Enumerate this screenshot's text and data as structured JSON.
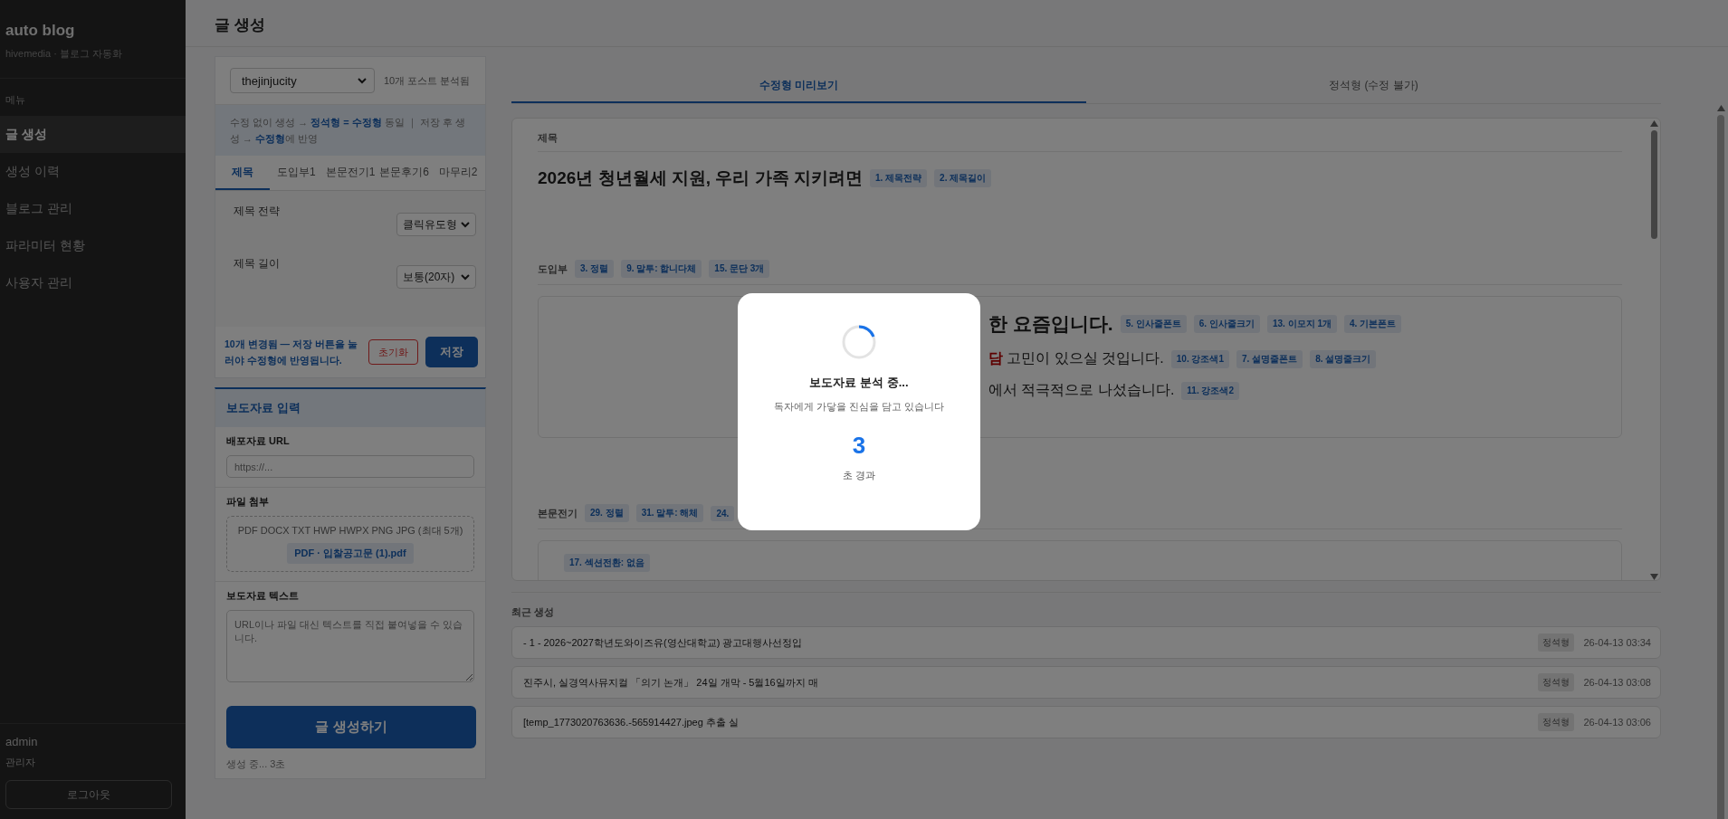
{
  "sidebar": {
    "brand": "auto blog",
    "subtitle": "hivemedia · 블로그 자동화",
    "section_label": "메뉴",
    "items": [
      {
        "label": "글 생성",
        "selected": true
      },
      {
        "label": "생성 이력",
        "selected": false
      },
      {
        "label": "블로그 관리",
        "selected": false
      },
      {
        "label": "파라미터 현황",
        "selected": false
      },
      {
        "label": "사용자 관리",
        "selected": false
      }
    ],
    "user": {
      "name": "admin",
      "role": "관리자"
    },
    "logout": "로그아웃"
  },
  "header": {
    "title": "글 생성"
  },
  "settings": {
    "blog_select": "thejinjucity",
    "analyzed": "10개 포스트 분석됨",
    "notice": "수정 없이 생성 → **정석형 = 수정형** 동일 ｜ 저장 후 생성 → **수정형**에 반영",
    "tabs": [
      {
        "label": "제목",
        "selected": true
      },
      {
        "label": "도입부1",
        "selected": false
      },
      {
        "label": "본문전기1",
        "selected": false
      },
      {
        "label": "본문후기6",
        "selected": false
      },
      {
        "label": "마무리2",
        "selected": false
      }
    ],
    "fields": [
      {
        "label": "제목 전략",
        "value": "클릭유도형"
      },
      {
        "label": "제목 길이",
        "value": "보통(20자)"
      }
    ],
    "footer_message": "10개 변경됨 — 저장 버튼을 눌러야 수정형에 반영됩니다.",
    "reset": "초기화",
    "save": "저장"
  },
  "press": {
    "title": "보도자료 입력",
    "url": {
      "label": "배포자료 URL",
      "placeholder": "https://..."
    },
    "file": {
      "label": "파일 첨부",
      "hint": "PDF DOCX TXT HWP HWPX PNG JPG (최대 5개)",
      "attachment": "PDF · 입찰공고문 (1).pdf"
    },
    "text": {
      "label": "보도자료 텍스트",
      "placeholder": "URL이나 파일 대신 텍스트를 직접 붙여넣을 수 있습니다."
    },
    "generate": "글 생성하기",
    "status": "생성 중... 3초"
  },
  "preview": {
    "tabs": [
      {
        "label": "수정형 미리보기",
        "selected": true
      },
      {
        "label": "정석형 (수정 불가)",
        "selected": false
      }
    ],
    "sections": [
      {
        "kind": "title",
        "label": "제목",
        "heading": "2026년 청년월세 지원, 우리 가족 지키려면",
        "tags": [
          "1. 제목전략",
          "2. 제목길이"
        ]
      },
      {
        "kind": "paragraphs",
        "label": "도입부",
        "tags": [
          "3. 정렬",
          "9. 말투: 합니다체",
          "15. 문단 3개"
        ],
        "lines": [
          {
            "kind": "lead",
            "text": "한 요즘입니다.",
            "tags": [
              "5. 인사줄폰트",
              "6. 인사줄크기",
              "13. 이모지 1개",
              "4. 기본폰트"
            ]
          },
          {
            "kind": "body",
            "text": "**담** 고민이 있으실 것입니다.",
            "tags": [
              "10. 강조색1",
              "7. 설명줄폰트",
              "8. 설명줄크기"
            ]
          },
          {
            "kind": "body",
            "text": "에서 적극적으로 나섰습니다.",
            "tags": [
              "11. 강조색2"
            ]
          }
        ]
      },
      {
        "kind": "tags_box",
        "label": "본문전기",
        "tags": [
          "29. 정렬",
          "31. 말투: 해체",
          "24."
        ],
        "box_tags": [
          "17. 섹션전환: 없음"
        ]
      }
    ]
  },
  "recent": {
    "title": "최근 생성",
    "items": [
      {
        "title": "- 1 - 2026~2027학년도와이즈유(영산대학교) 광고대행사선정입",
        "badge": "정석형",
        "time": "26-04-13 03:34"
      },
      {
        "title": "진주시, 실경역사뮤지컬 「의기 논개」 24일 개막 - 5월16일까지 매",
        "badge": "정석형",
        "time": "26-04-13 03:08"
      },
      {
        "title": "[temp_1773020763636.-565914427.jpeg 추출 실",
        "badge": "정석형",
        "time": "26-04-13 03:06"
      }
    ]
  },
  "modal": {
    "title": "보도자료 분석 중...",
    "subtitle": "독자에게 가닿을 진심을 담고 있습니다",
    "count": "3",
    "unit": "초 경과"
  }
}
